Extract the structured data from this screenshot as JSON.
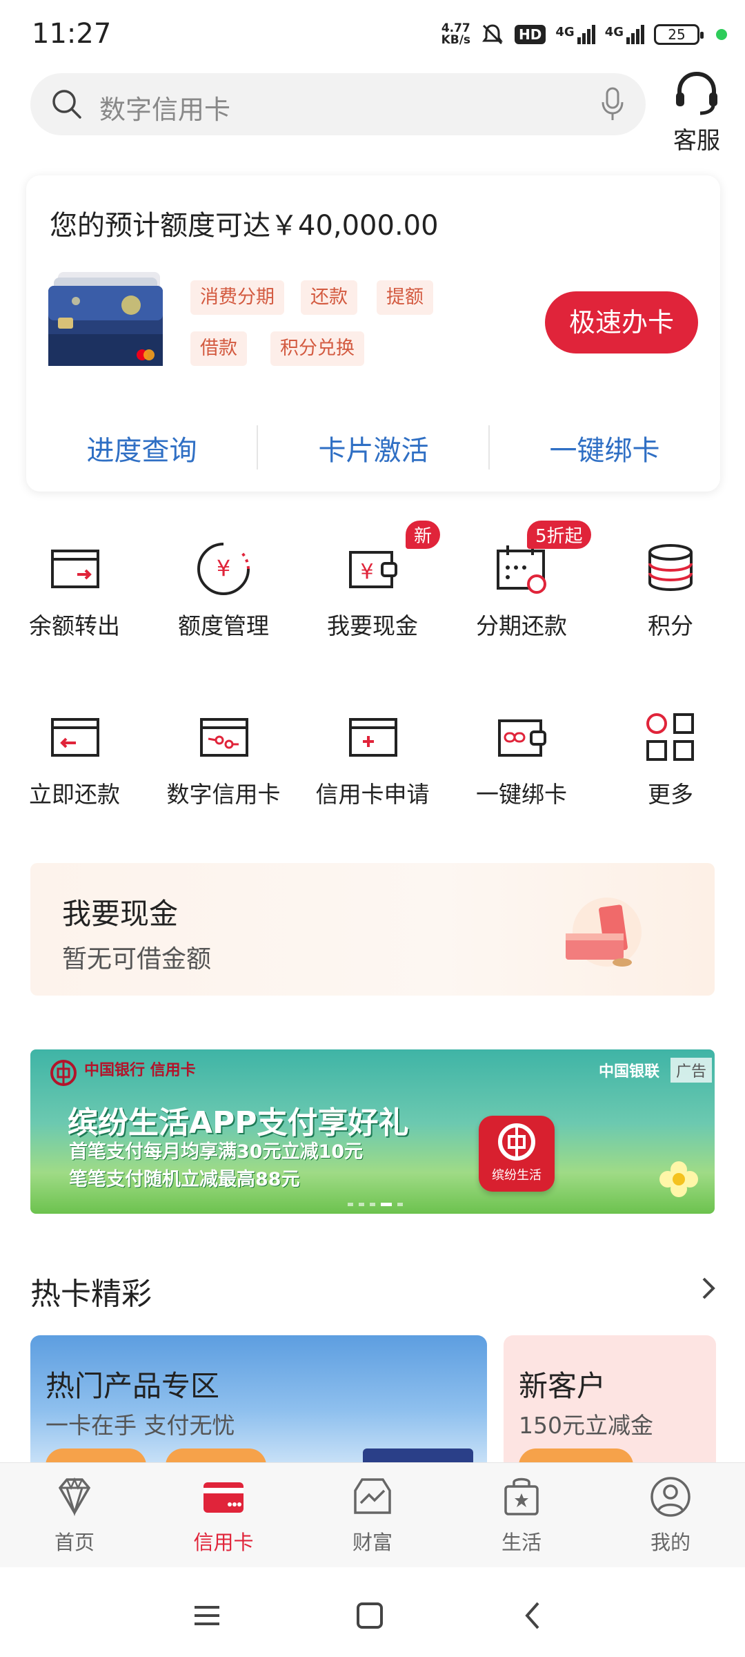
{
  "status_bar": {
    "time": "11:27",
    "net_speed_value": "4.77",
    "net_speed_unit": "KB/s",
    "hd_label": "HD",
    "signal_1_label": "4G",
    "signal_2_label": "4G",
    "battery_level": "25"
  },
  "search": {
    "placeholder": "数字信用卡",
    "service_label": "客服"
  },
  "card_panel": {
    "limit_text": "您的预计额度可达￥40,000.00",
    "tags": [
      "消费分期",
      "还款",
      "提额",
      "借款",
      "积分兑换"
    ],
    "apply_button": "极速办卡",
    "links": [
      "进度查询",
      "卡片激活",
      "一键绑卡"
    ]
  },
  "grid": {
    "row1": [
      {
        "label": "余额转出",
        "icon": "wallet-transfer-icon"
      },
      {
        "label": "额度管理",
        "icon": "yuan-circle-icon"
      },
      {
        "label": "我要现金",
        "icon": "cash-wallet-icon",
        "badge": "新"
      },
      {
        "label": "分期还款",
        "icon": "calendar-installment-icon",
        "badge": "5折起"
      },
      {
        "label": "积分",
        "icon": "points-coins-icon"
      }
    ],
    "row2": [
      {
        "label": "立即还款",
        "icon": "card-repay-icon"
      },
      {
        "label": "数字信用卡",
        "icon": "digital-card-icon"
      },
      {
        "label": "信用卡申请",
        "icon": "card-apply-icon"
      },
      {
        "label": "一键绑卡",
        "icon": "link-card-icon"
      },
      {
        "label": "更多",
        "icon": "more-grid-icon"
      }
    ]
  },
  "cash_banner": {
    "title": "我要现金",
    "subtitle": "暂无可借金额"
  },
  "promo_banner": {
    "boc_text": "中国银行  信用卡",
    "unionpay_text": "中国银联",
    "ad_tag": "广告",
    "title": "缤纷生活APP支付享好礼",
    "line1": "首笔支付每月均享满30元立减10元",
    "line2": "笔笔支付随机立减最高88元",
    "app_label": "缤纷生活"
  },
  "hot_cards": {
    "title": "热卡精彩",
    "card1_title": "热门产品专区",
    "card1_sub": "一卡在手 支付无忧",
    "card2_title": "新客户",
    "card2_sub": "150元立减金"
  },
  "bottom_nav": [
    {
      "label": "首页",
      "icon": "diamond-icon",
      "active": false
    },
    {
      "label": "信用卡",
      "icon": "credit-card-icon",
      "active": true
    },
    {
      "label": "财富",
      "icon": "wealth-chart-icon",
      "active": false
    },
    {
      "label": "生活",
      "icon": "shopping-bag-icon",
      "active": false
    },
    {
      "label": "我的",
      "icon": "profile-icon",
      "active": false
    }
  ],
  "colors": {
    "accent_red": "#e0243a",
    "link_blue": "#2f6fc4",
    "tag_bg": "#fdeee9",
    "tag_text": "#d35a40"
  }
}
